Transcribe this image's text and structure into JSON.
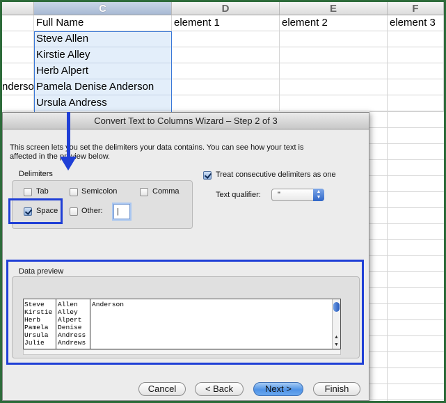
{
  "sheet": {
    "columns": [
      "C",
      "D",
      "E",
      "F"
    ],
    "header_row": [
      "Full Name",
      "element 1",
      "element 2",
      "element 3"
    ],
    "names": [
      "Steve Allen",
      "Kirstie Alley",
      "Herb Alpert",
      "Pamela Denise Anderson",
      "Ursula Andress"
    ],
    "clipped_left": "nderson"
  },
  "dialog": {
    "title": "Convert Text to Columns Wizard – Step 2 of 3",
    "intro_line1": "This screen lets you set the delimiters your data contains.  You can see how your text is",
    "intro_line2": "affected in the preview below.",
    "delimiters_label": "Delimiters",
    "tab_label": "Tab",
    "semicolon_label": "Semicolon",
    "comma_label": "Comma",
    "space_label": "Space",
    "other_label": "Other:",
    "other_value": "|",
    "consecutive_label": "Treat consecutive delimiters as one",
    "qualifier_label": "Text qualifier:",
    "qualifier_value": "\"",
    "preview_label": "Data preview",
    "preview": {
      "col1": [
        "Steve",
        "Kirstie",
        "Herb",
        "Pamela",
        "Ursula",
        "Julie"
      ],
      "col2": [
        "Allen",
        "Alley",
        "Alpert",
        "Denise",
        "Andress",
        "Andrews"
      ],
      "col3": [
        "",
        "",
        "",
        "Anderson",
        "",
        ""
      ]
    },
    "buttons": {
      "cancel": "Cancel",
      "back": "< Back",
      "next": "Next >",
      "finish": "Finish"
    }
  },
  "colors": {
    "annotation_blue": "#1f3fd6",
    "frame_green": "#2d6b3a"
  }
}
